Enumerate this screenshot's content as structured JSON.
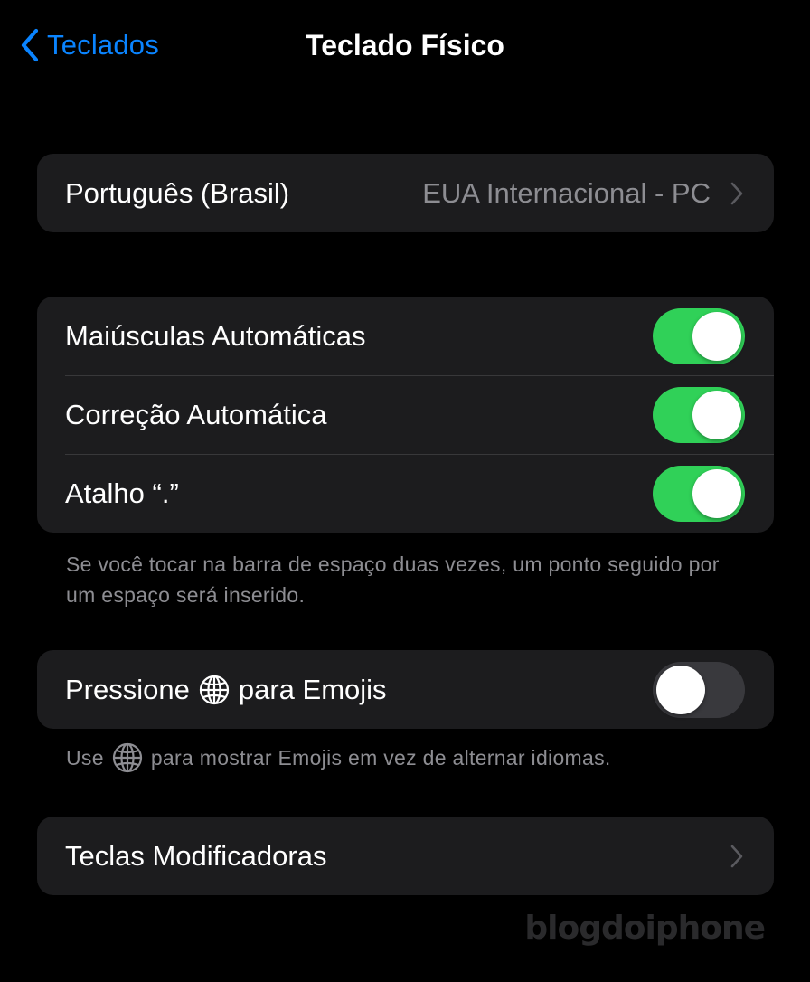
{
  "nav": {
    "back_label": "Teclados",
    "title": "Teclado Físico"
  },
  "layout_row": {
    "label": "Português (Brasil)",
    "value": "EUA Internacional - PC"
  },
  "toggles": [
    {
      "label": "Maiúsculas Automáticas",
      "on": true
    },
    {
      "label": "Correção Automática",
      "on": true
    },
    {
      "label": "Atalho “.”",
      "on": true
    }
  ],
  "toggles_footer": "Se você tocar na barra de espaço duas vezes, um ponto seguido por um espaço será inserido.",
  "emoji_row": {
    "label_prefix": "Pressione",
    "label_suffix": "para Emojis",
    "on": false
  },
  "emoji_footer": {
    "prefix": "Use",
    "suffix": "para mostrar Emojis em vez de alternar idiomas."
  },
  "modifier_row": {
    "label": "Teclas Modificadoras"
  },
  "watermark": "blogdoiphone",
  "colors": {
    "accent": "#0a84ff",
    "toggle_on": "#30d158",
    "toggle_off": "#39393d",
    "cell_bg": "#1c1c1e",
    "secondary_text": "#8d8d92"
  }
}
